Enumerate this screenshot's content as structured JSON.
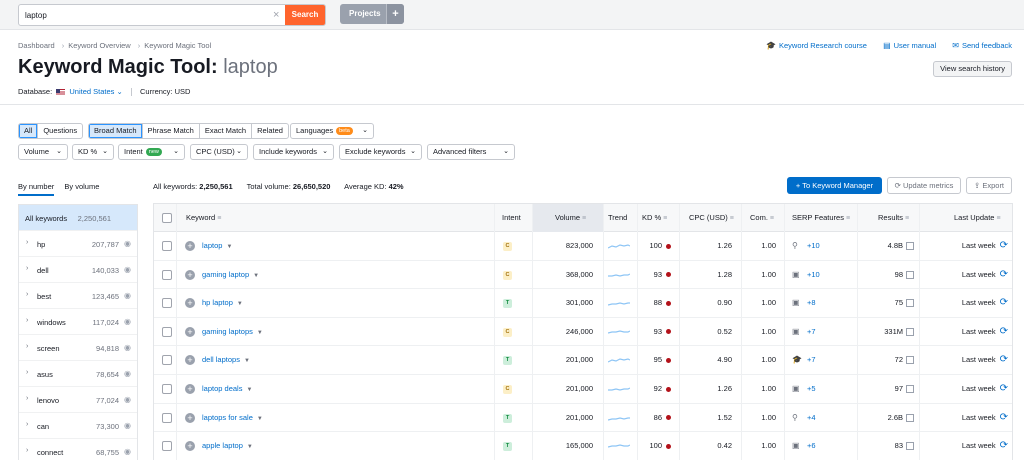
{
  "search": {
    "value": "laptop",
    "clear_icon": "×",
    "button": "Search"
  },
  "projects": {
    "label": "Projects",
    "plus": "+"
  },
  "breadcrumb": [
    "Dashboard",
    "Keyword Overview",
    "Keyword Magic Tool"
  ],
  "help_links": [
    "Keyword Research course",
    "User manual",
    "Send feedback"
  ],
  "title": {
    "main": "Keyword Magic Tool:",
    "keyword": "laptop"
  },
  "view_history": "View search history",
  "database": {
    "label": "Database:",
    "country": "United States",
    "currency": "Currency: USD"
  },
  "match_tabs": [
    "All",
    "Questions"
  ],
  "match_types": [
    "Broad Match",
    "Phrase Match",
    "Exact Match",
    "Related"
  ],
  "languages": {
    "label": "Languages",
    "badge": "beta"
  },
  "filters": {
    "volume": "Volume",
    "kd": "KD %",
    "intent": "Intent",
    "intent_badge": "new",
    "cpc": "CPC (USD)",
    "include": "Include keywords",
    "exclude": "Exclude keywords",
    "advanced": "Advanced filters"
  },
  "sidebar": {
    "tabs": [
      "By number",
      "By volume"
    ],
    "all": {
      "name": "All keywords",
      "count": "2,250,561"
    },
    "groups": [
      {
        "name": "hp",
        "count": "207,787"
      },
      {
        "name": "dell",
        "count": "140,033"
      },
      {
        "name": "best",
        "count": "123,465"
      },
      {
        "name": "windows",
        "count": "117,024"
      },
      {
        "name": "screen",
        "count": "94,818"
      },
      {
        "name": "asus",
        "count": "78,654"
      },
      {
        "name": "lenovo",
        "count": "77,024"
      },
      {
        "name": "can",
        "count": "73,300"
      },
      {
        "name": "connect",
        "count": "68,755"
      }
    ]
  },
  "stats": {
    "all_label": "All keywords:",
    "all_value": "2,250,561",
    "vol_label": "Total volume:",
    "vol_value": "26,650,520",
    "kd_label": "Average KD:",
    "kd_value": "42%"
  },
  "actions": {
    "to_manager": "To Keyword Manager",
    "update": "Update metrics",
    "export": "Export"
  },
  "table": {
    "headers": [
      "Keyword",
      "Intent",
      "Volume",
      "Trend",
      "KD %",
      "CPC (USD)",
      "Com.",
      "SERP Features",
      "Results",
      "Last Update"
    ],
    "rows": [
      {
        "keyword": "laptop",
        "intent": "C",
        "volume": "823,000",
        "kd": "100",
        "cpc": "1.26",
        "com": "1.00",
        "serp_icon": "location-pin-icon",
        "serp": "+10",
        "results": "4.8B",
        "update": "Last week"
      },
      {
        "keyword": "gaming laptop",
        "intent": "C",
        "volume": "368,000",
        "kd": "93",
        "cpc": "1.28",
        "com": "1.00",
        "serp_icon": "image-icon",
        "serp": "+10",
        "results": "98",
        "update": "Last week"
      },
      {
        "keyword": "hp laptop",
        "intent": "T",
        "volume": "301,000",
        "kd": "88",
        "cpc": "0.90",
        "com": "1.00",
        "serp_icon": "image-icon",
        "serp": "+8",
        "results": "75",
        "update": "Last week"
      },
      {
        "keyword": "gaming laptops",
        "intent": "C",
        "volume": "246,000",
        "kd": "93",
        "cpc": "0.52",
        "com": "1.00",
        "serp_icon": "image-icon",
        "serp": "+7",
        "results": "331M",
        "update": "Last week"
      },
      {
        "keyword": "dell laptops",
        "intent": "T",
        "volume": "201,000",
        "kd": "95",
        "cpc": "4.90",
        "com": "1.00",
        "serp_icon": "graduation-cap-icon",
        "serp": "+7",
        "results": "72",
        "update": "Last week"
      },
      {
        "keyword": "laptop deals",
        "intent": "C",
        "volume": "201,000",
        "kd": "92",
        "cpc": "1.26",
        "com": "1.00",
        "serp_icon": "image-icon",
        "serp": "+5",
        "results": "97",
        "update": "Last week"
      },
      {
        "keyword": "laptops for sale",
        "intent": "T",
        "volume": "201,000",
        "kd": "86",
        "cpc": "1.52",
        "com": "1.00",
        "serp_icon": "location-pin-icon",
        "serp": "+4",
        "results": "2.6B",
        "update": "Last week"
      },
      {
        "keyword": "apple laptop",
        "intent": "T",
        "volume": "165,000",
        "kd": "100",
        "cpc": "0.42",
        "com": "1.00",
        "serp_icon": "image-icon",
        "serp": "+6",
        "results": "83",
        "update": "Last week"
      }
    ]
  },
  "colors": {
    "accent": "#006dca",
    "search_button": "#ff642d",
    "kd_dot": "#b3121a"
  }
}
